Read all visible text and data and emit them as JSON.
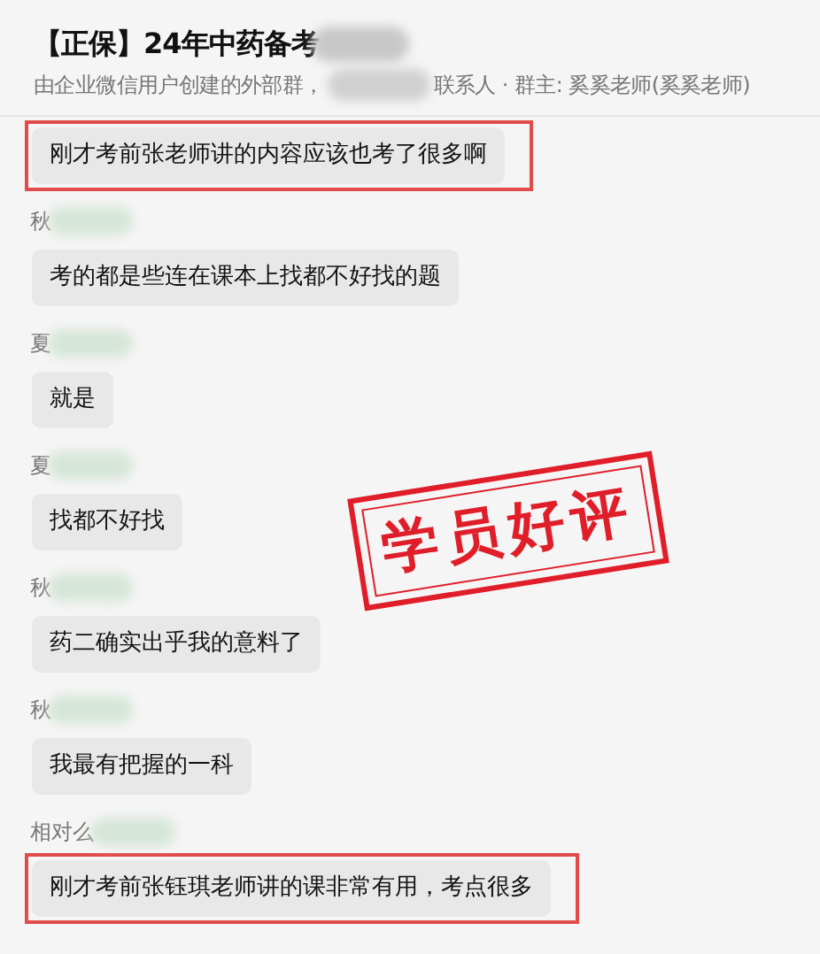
{
  "header": {
    "title": "【正保】24年中药备考",
    "title_redacted": true,
    "subtitle_before": "由企业微信用户创建的外部群，",
    "subtitle_after": "联系人 · 群主: 奚奚老师(奚奚老师)"
  },
  "messages": [
    {
      "highlighted": true,
      "text": "刚才考前张老师讲的内容应该也考了很多啊"
    },
    {
      "sender": "秋",
      "highlighted": false,
      "text": "考的都是些连在课本上找都不好找的题"
    },
    {
      "sender": "夏",
      "highlighted": false,
      "text": "就是"
    },
    {
      "sender": "夏",
      "highlighted": false,
      "text": "找都不好找"
    },
    {
      "sender": "秋",
      "highlighted": false,
      "text": "药二确实出乎我的意料了"
    },
    {
      "sender": "秋",
      "highlighted": false,
      "text": "我最有把握的一科"
    },
    {
      "sender": "相对么",
      "highlighted": true,
      "text": "刚才考前张钰琪老师讲的课非常有用，考点很多"
    }
  ],
  "stamp": {
    "text": "学员好评"
  }
}
